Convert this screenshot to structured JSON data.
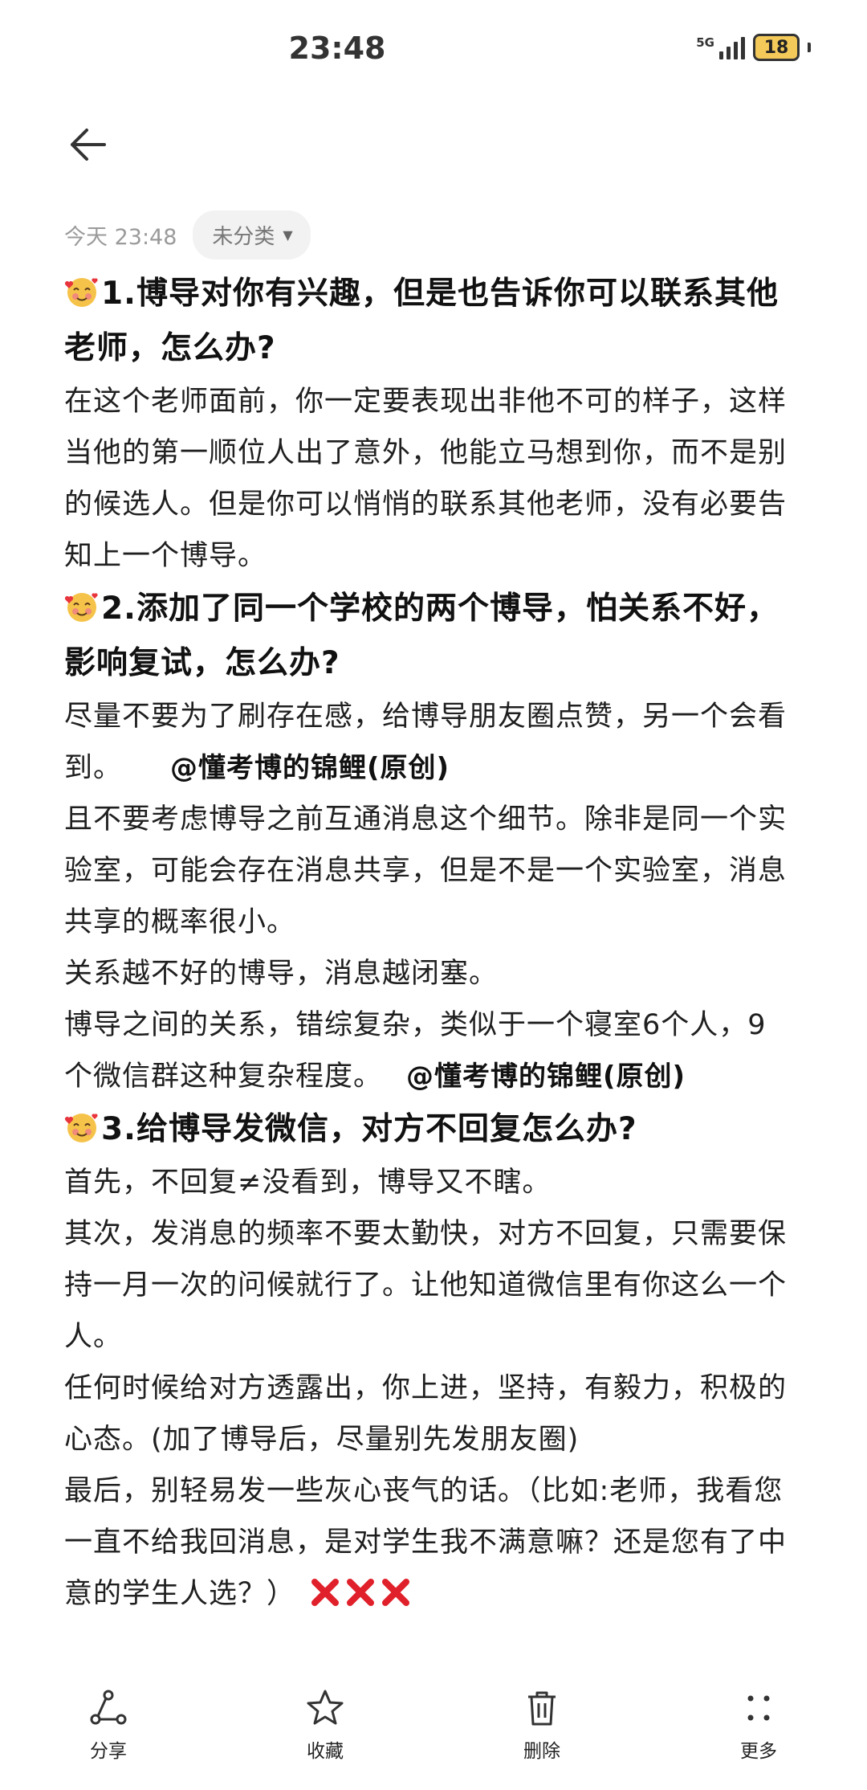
{
  "status_bar": {
    "time": "23:48",
    "network": "5G",
    "battery": "18"
  },
  "note": {
    "date": "今天 23:48",
    "category": "未分类"
  },
  "sections": [
    {
      "heading": "1.博导对你有兴趣，但是也告诉你可以联系其他老师，怎么办?",
      "paragraphs": [
        "在这个老师面前，你一定要表现出非他不可的样子，这样当他的第一顺位人出了意外，他能立马想到你，而不是别的候选人。但是你可以悄悄的联系其他老师，没有必要告知上一个博导。"
      ]
    },
    {
      "heading": "2.添加了同一个学校的两个博导，怕关系不好，影响复试，怎么办?",
      "p1": "尽量不要为了刷存在感，给博导朋友圈点赞，另一个会看到。",
      "watermark1": "@懂考博的锦鲤(原创)",
      "p2": "且不要考虑博导之前互通消息这个细节。除非是同一个实验室，可能会存在消息共享，但是不是一个实验室，消息共享的概率很小。",
      "p3": "关系越不好的博导，消息越闭塞。",
      "p4": "博导之间的关系，错综复杂，类似于一个寝室6个人，9个微信群这种复杂程度。",
      "watermark2": "@懂考博的锦鲤(原创)"
    },
    {
      "heading": "3.给博导发微信，对方不回复怎么办?",
      "p1": "首先，不回复≠没看到，博导又不瞎。",
      "p2": "其次，发消息的频率不要太勤快，对方不回复，只需要保持一月一次的问候就行了。让他知道微信里有你这么一个人。",
      "p3": "任何时候给对方透露出，你上进，坚持，有毅力，积极的心态。(加了博导后，尽量别先发朋友圈)",
      "p4": "最后，别轻易发一些灰心丧气的话。（比如:老师，我看您一直不给我回消息，是对学生我不满意嘛？还是您有了中意的学生人选？）"
    }
  ],
  "toolbar": {
    "share": "分享",
    "favorite": "收藏",
    "delete": "删除",
    "more": "更多"
  },
  "icons": {
    "emoji": "smiling-face-with-hearts-icon",
    "cross": "cross-mark-icon",
    "back": "back-arrow-icon"
  }
}
